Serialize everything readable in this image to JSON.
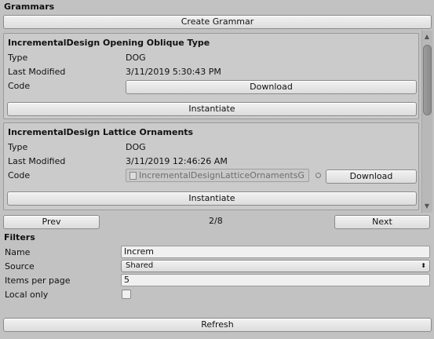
{
  "panel": {
    "title": "Grammars",
    "create_button": "Create Grammar"
  },
  "cards": [
    {
      "title": "IncrementalDesign Opening Oblique Type",
      "type_label": "Type",
      "type_value": "DOG",
      "modified_label": "Last Modified",
      "modified_value": "3/11/2019 5:30:43 PM",
      "code_label": "Code",
      "download_button": "Download",
      "instantiate_button": "Instantiate"
    },
    {
      "title": "IncrementalDesign Lattice Ornaments",
      "type_label": "Type",
      "type_value": "DOG",
      "modified_label": "Last Modified",
      "modified_value": "3/11/2019 12:46:26 AM",
      "code_label": "Code",
      "code_object": "IncrementalDesignLatticeOrnamentsG",
      "download_button": "Download",
      "instantiate_button": "Instantiate"
    }
  ],
  "pagination": {
    "prev": "Prev",
    "page": "2/8",
    "next": "Next"
  },
  "filters": {
    "title": "Filters",
    "name_label": "Name",
    "name_value": "Increm",
    "source_label": "Source",
    "source_value": "Shared",
    "items_label": "Items per page",
    "items_value": "5",
    "local_label": "Local only",
    "local_checked": false
  },
  "refresh_button": "Refresh",
  "icons": {
    "scroll_up": "triangle-up-icon",
    "scroll_down": "triangle-down-icon",
    "dropdown": "updown-arrows-icon",
    "object_picker": "circle-picker-icon",
    "script_file": "file-icon"
  }
}
